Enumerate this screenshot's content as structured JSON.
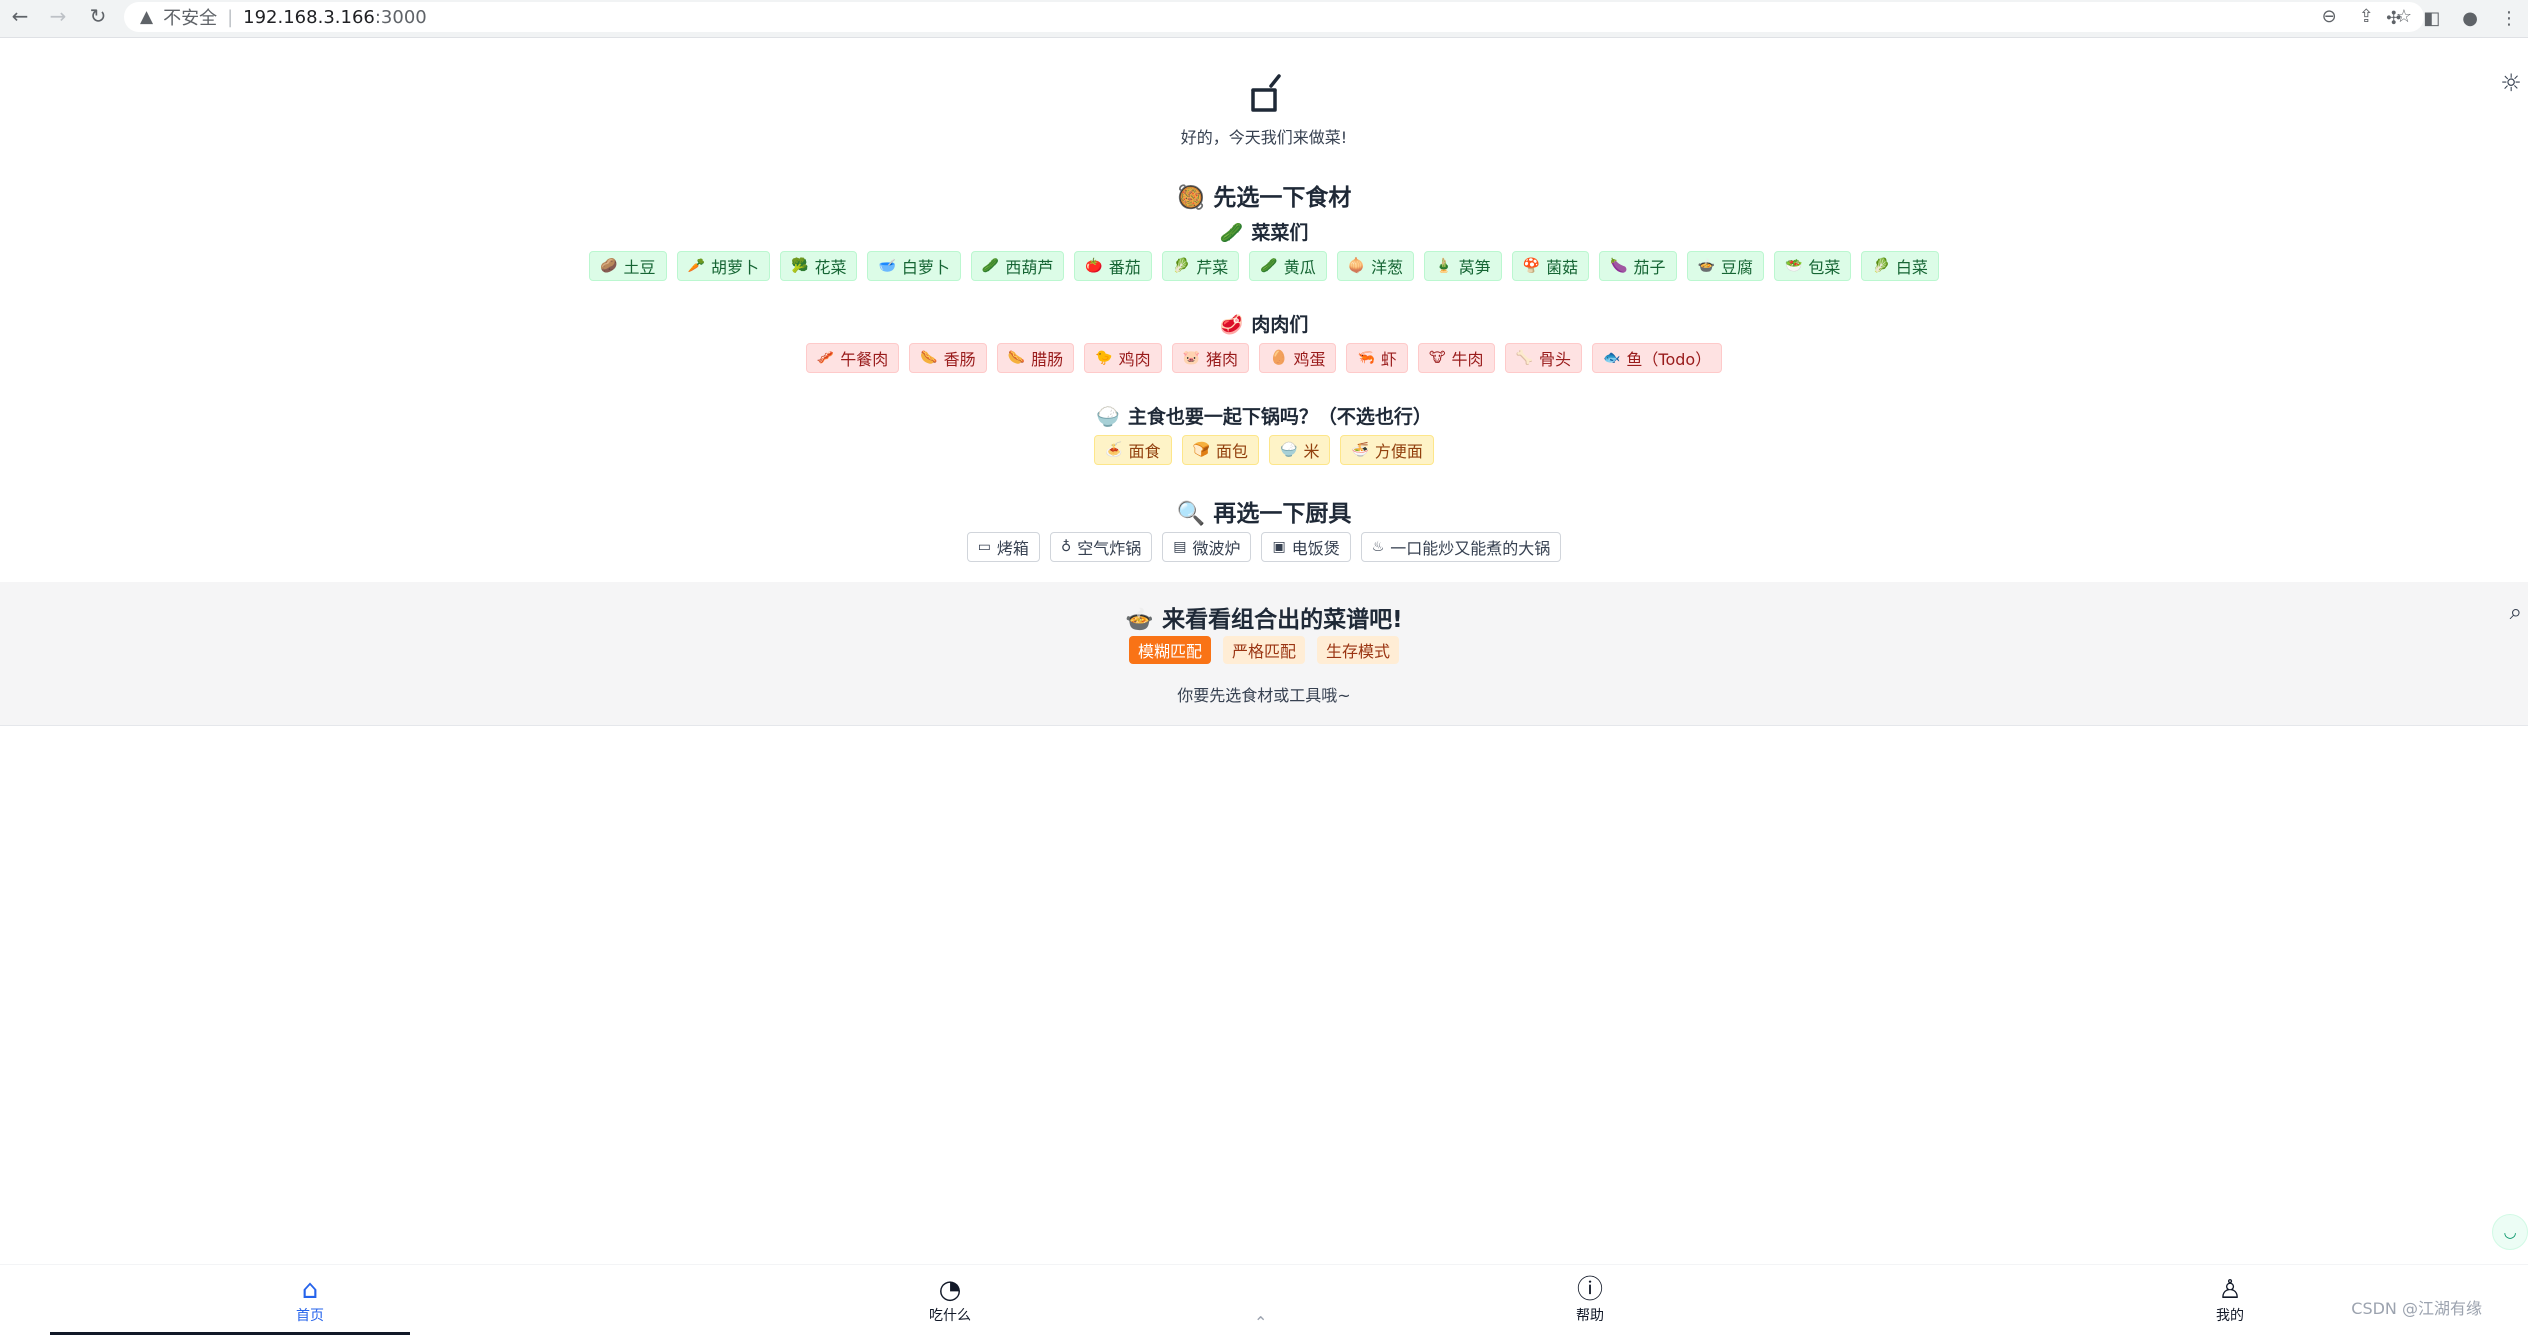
{
  "browser": {
    "security_label": "不安全",
    "url_host": "192.168.3.166",
    "url_port": ":3000"
  },
  "header": {
    "subtitle": "好的，今天我们来做菜!"
  },
  "ingredients_section": {
    "title": "先选一下食材",
    "vegetables_title": "菜菜们",
    "vegetables": [
      {
        "icon": "🥔",
        "label": "土豆"
      },
      {
        "icon": "🥕",
        "label": "胡萝卜"
      },
      {
        "icon": "🥦",
        "label": "花菜"
      },
      {
        "icon": "🥣",
        "label": "白萝卜"
      },
      {
        "icon": "🥒",
        "label": "西葫芦"
      },
      {
        "icon": "🍅",
        "label": "番茄"
      },
      {
        "icon": "🥬",
        "label": "芹菜"
      },
      {
        "icon": "🥒",
        "label": "黄瓜"
      },
      {
        "icon": "🧅",
        "label": "洋葱"
      },
      {
        "icon": "🎍",
        "label": "莴笋"
      },
      {
        "icon": "🍄",
        "label": "菌菇"
      },
      {
        "icon": "🍆",
        "label": "茄子"
      },
      {
        "icon": "🍲",
        "label": "豆腐"
      },
      {
        "icon": "🥗",
        "label": "包菜"
      },
      {
        "icon": "🥬",
        "label": "白菜"
      }
    ],
    "meats_title": "肉肉们",
    "meats": [
      {
        "icon": "🥓",
        "label": "午餐肉"
      },
      {
        "icon": "🌭",
        "label": "香肠"
      },
      {
        "icon": "🌭",
        "label": "腊肠"
      },
      {
        "icon": "🐤",
        "label": "鸡肉"
      },
      {
        "icon": "🐷",
        "label": "猪肉"
      },
      {
        "icon": "🥚",
        "label": "鸡蛋"
      },
      {
        "icon": "🦐",
        "label": "虾"
      },
      {
        "icon": "🐮",
        "label": "牛肉"
      },
      {
        "icon": "🦴",
        "label": "骨头"
      },
      {
        "icon": "🐟",
        "label": "鱼（Todo）"
      }
    ],
    "staples_title": "主食也要一起下锅吗？（不选也行）",
    "staples": [
      {
        "icon": "🍝",
        "label": "面食"
      },
      {
        "icon": "🍞",
        "label": "面包"
      },
      {
        "icon": "🍚",
        "label": "米"
      },
      {
        "icon": "🍜",
        "label": "方便面"
      }
    ]
  },
  "tools_section": {
    "title": "再选一下厨具",
    "tools": [
      {
        "icon": "▭",
        "label": "烤箱"
      },
      {
        "icon": "♁",
        "label": "空气炸锅"
      },
      {
        "icon": "▤",
        "label": "微波炉"
      },
      {
        "icon": "▣",
        "label": "电饭煲"
      },
      {
        "icon": "♨",
        "label": "一口能炒又能煮的大锅"
      }
    ]
  },
  "result": {
    "title": "来看看组合出的菜谱吧!",
    "modes": [
      "模糊匹配",
      "严格匹配",
      "生存模式"
    ],
    "active_mode": "模糊匹配",
    "hint": "你要先选食材或工具哦~"
  },
  "bottom_nav": {
    "items": [
      {
        "label": "首页",
        "icon": "home-icon"
      },
      {
        "label": "吃什么",
        "icon": "compass-icon"
      },
      {
        "label": "帮助",
        "icon": "help-icon"
      },
      {
        "label": "我的",
        "icon": "user-icon"
      }
    ],
    "active": "首页"
  },
  "watermark": "CSDN @江湖有缘"
}
